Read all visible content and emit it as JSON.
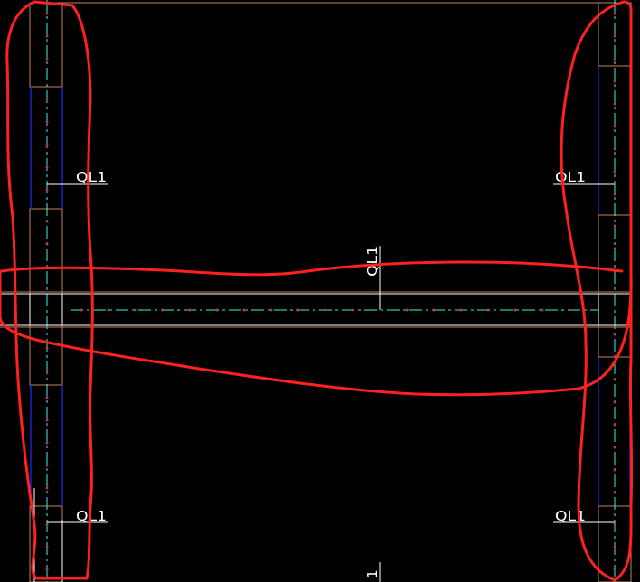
{
  "drawing": {
    "background": "#000000",
    "colors": {
      "outline": "#c8825a",
      "center_line": "#3ff0e8",
      "wall_edge": "#2828ff",
      "rebar_dot": "#b43c3c",
      "label": "#ffffff",
      "redline": "#ff2020"
    },
    "labels": {
      "beam_top_left": "QL1",
      "beam_top_right": "QL1",
      "beam_bottom_left": "QL1",
      "beam_bottom_right": "QL1",
      "beam_middle_vertical": "QL1",
      "bottom_vertical": "1"
    }
  }
}
